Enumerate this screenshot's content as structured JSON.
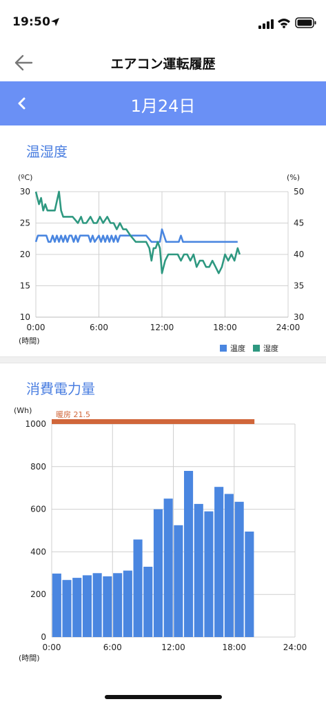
{
  "status": {
    "time": "19:50"
  },
  "header": {
    "title": "エアコン運転履歴"
  },
  "date_nav": {
    "date": "1月24日"
  },
  "temp_section": {
    "title": "温湿度"
  },
  "power_section": {
    "title": "消費電力量"
  },
  "colors": {
    "accent": "#6a90f5",
    "temperature": "#4a86e0",
    "humidity": "#2e9880",
    "heating": "#d0663a",
    "bar": "#4a86e0"
  },
  "chart_data": [
    {
      "type": "line",
      "title": "温湿度",
      "left_unit": "(ºC)",
      "right_unit": "(%)",
      "x_unit": "(時間)",
      "x_ticks": [
        "0:00",
        "6:00",
        "12:00",
        "18:00",
        "24:00"
      ],
      "y_ticks": [
        10,
        15,
        20,
        25,
        30
      ],
      "y2_ticks": [
        30,
        35,
        40,
        45,
        50
      ],
      "xlim": [
        0,
        24
      ],
      "ylim": [
        10,
        30
      ],
      "y2lim": [
        30,
        50
      ],
      "grid": true,
      "legend_position": "bottom-right",
      "series": [
        {
          "name": "温度",
          "axis": "left",
          "x": [
            0,
            0.2,
            0.5,
            1.0,
            1.2,
            1.4,
            1.6,
            1.8,
            2.0,
            2.2,
            2.4,
            2.6,
            2.8,
            3.0,
            3.2,
            3.4,
            3.6,
            3.8,
            4.0,
            4.2,
            4.5,
            5.0,
            5.2,
            5.4,
            5.6,
            6.0,
            6.2,
            6.4,
            6.6,
            6.8,
            7.0,
            7.2,
            7.4,
            7.6,
            7.8,
            8.0,
            8.2,
            8.4,
            9.0,
            10.0,
            10.5,
            11.0,
            11.4,
            11.8,
            12.0,
            12.2,
            12.4,
            12.6,
            13.0,
            13.6,
            13.8,
            14.0,
            15.0,
            16.0,
            17.0,
            18.0,
            19.0,
            19.2
          ],
          "values": [
            22,
            23,
            23,
            23,
            22,
            22,
            23,
            22,
            23,
            22,
            23,
            22,
            23,
            22,
            23,
            23,
            22,
            23,
            22,
            23,
            23,
            23,
            22,
            23,
            22,
            23,
            22,
            23,
            22,
            23,
            22,
            23,
            22,
            23,
            22,
            23,
            23,
            23,
            23,
            23,
            23,
            22,
            22,
            22,
            24,
            23,
            22,
            22,
            22,
            22,
            23,
            22,
            22,
            22,
            22,
            22,
            22,
            22
          ]
        },
        {
          "name": "湿度",
          "axis": "right",
          "x": [
            0,
            0.3,
            0.5,
            0.7,
            0.9,
            1.1,
            1.4,
            1.8,
            2.2,
            2.4,
            2.6,
            3.0,
            3.5,
            4.0,
            4.3,
            4.5,
            4.8,
            5.2,
            5.5,
            5.8,
            6.1,
            6.4,
            6.8,
            7.1,
            7.4,
            7.7,
            8.0,
            8.3,
            8.6,
            9.0,
            9.5,
            10.0,
            10.5,
            10.8,
            11.0,
            11.2,
            11.4,
            11.6,
            11.8,
            12.0,
            12.3,
            12.6,
            13.0,
            13.5,
            13.8,
            14.1,
            14.4,
            14.7,
            15.0,
            15.3,
            15.6,
            15.9,
            16.2,
            16.5,
            16.8,
            17.1,
            17.4,
            17.7,
            18.0,
            18.3,
            18.6,
            18.9,
            19.2,
            19.4
          ],
          "values": [
            50,
            48,
            49,
            47,
            48,
            47,
            47,
            47,
            50,
            47,
            46,
            46,
            46,
            45,
            46,
            45,
            45,
            46,
            45,
            45,
            46,
            45,
            46,
            45,
            45,
            44,
            45,
            44,
            44,
            43,
            42,
            42,
            42,
            41,
            39,
            41,
            41,
            42,
            41,
            37,
            39,
            40,
            40,
            40,
            39,
            40,
            40,
            39,
            40,
            38,
            39,
            39,
            38,
            38,
            39,
            38,
            37,
            38,
            40,
            39,
            40,
            39,
            41,
            40
          ]
        }
      ]
    },
    {
      "type": "bar",
      "title": "消費電力量",
      "y_unit": "(Wh)",
      "x_unit": "(時間)",
      "x_ticks": [
        "0:00",
        "6:00",
        "12:00",
        "18:00",
        "24:00"
      ],
      "y_ticks": [
        0,
        200,
        400,
        600,
        800,
        1000
      ],
      "ylim": [
        0,
        1000
      ],
      "xlim": [
        0,
        24
      ],
      "grid": true,
      "annotation": {
        "label": "暖房 21.5",
        "start_hour": 0,
        "end_hour": 20
      },
      "categories": [
        0,
        1,
        2,
        3,
        4,
        5,
        6,
        7,
        8,
        9,
        10,
        11,
        12,
        13,
        14,
        15,
        16,
        17,
        18,
        19
      ],
      "values": [
        298,
        268,
        278,
        290,
        300,
        285,
        300,
        312,
        458,
        330,
        600,
        650,
        525,
        780,
        625,
        590,
        705,
        672,
        635,
        495
      ]
    }
  ]
}
